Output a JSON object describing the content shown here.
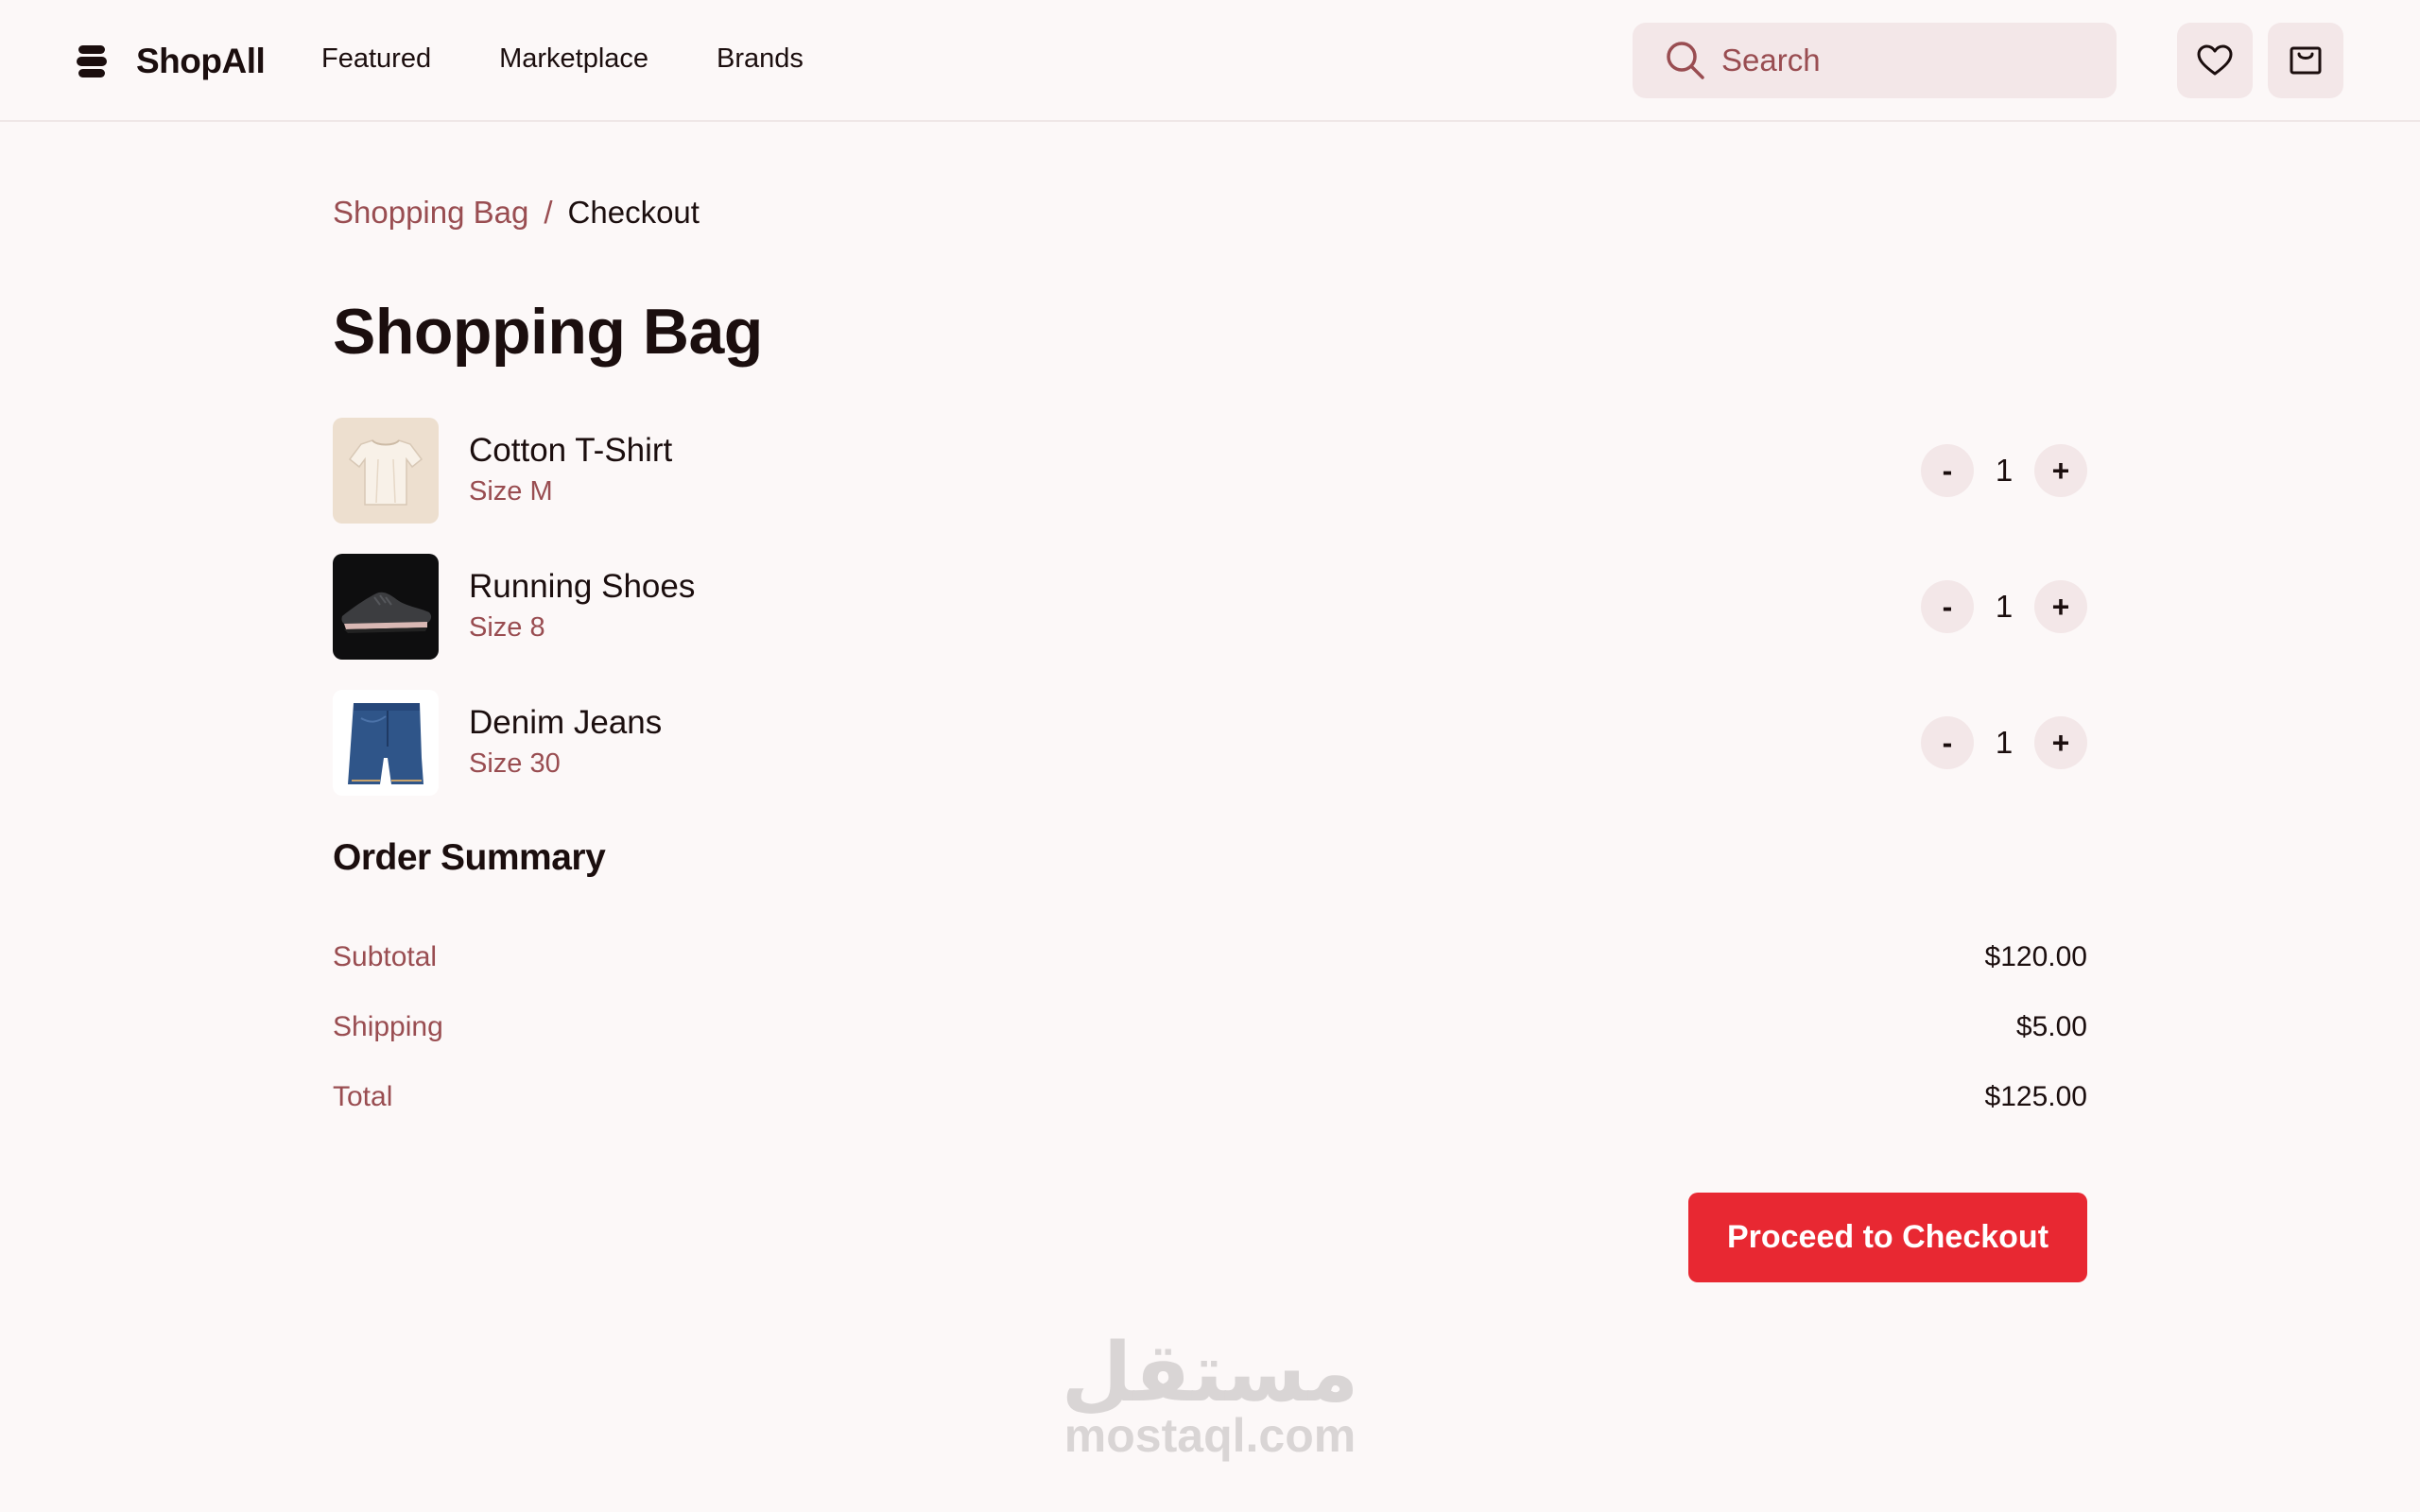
{
  "header": {
    "brand": "ShopAll",
    "nav": [
      {
        "label": "Featured"
      },
      {
        "label": "Marketplace"
      },
      {
        "label": "Brands"
      }
    ],
    "search": {
      "placeholder": "Search",
      "icon": "search-icon"
    },
    "icons": [
      "heart-icon",
      "shopping-bag-icon"
    ]
  },
  "breadcrumb": {
    "parent": "Shopping Bag",
    "separator": "/",
    "current": "Checkout"
  },
  "page_title": "Shopping Bag",
  "items": [
    {
      "name": "Cotton T-Shirt",
      "size": "Size M",
      "quantity": "1",
      "decrement": "-",
      "increment": "+"
    },
    {
      "name": "Running Shoes",
      "size": "Size 8",
      "quantity": "1",
      "decrement": "-",
      "increment": "+"
    },
    {
      "name": "Denim Jeans",
      "size": "Size 30",
      "quantity": "1",
      "decrement": "-",
      "increment": "+"
    }
  ],
  "order_summary": {
    "title": "Order Summary",
    "rows": [
      {
        "label": "Subtotal",
        "value": "$120.00"
      },
      {
        "label": "Shipping",
        "value": "$5.00"
      },
      {
        "label": "Total",
        "value": "$125.00"
      }
    ]
  },
  "checkout_button": "Proceed to Checkout",
  "watermark": {
    "arabic": "مستقل",
    "latin": "mostaql.com"
  },
  "colors": {
    "background": "#fcf8f8",
    "text": "#1b0e0e",
    "accent_text": "#994d51",
    "chip": "#f3e7e8",
    "primary": "#e82832"
  }
}
